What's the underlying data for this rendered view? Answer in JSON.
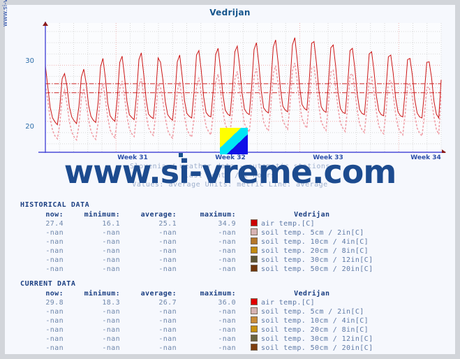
{
  "site": {
    "vertical_label": "www.si-vreme.com",
    "watermark": "www.si-vreme.com"
  },
  "header": {
    "title": "Vedrijan"
  },
  "captions": {
    "line1": "Slovenia / weather data - automatic stations",
    "line2": "last month / 2 hours",
    "line3": "Values: average  Units: metric  Line: average"
  },
  "chart_data": {
    "type": "line",
    "title": "Vedrijan",
    "xlabel": "",
    "ylabel": "",
    "ylim": [
      14.5,
      37.5
    ],
    "yticks": [
      20,
      30
    ],
    "ytick_labels": [
      "20",
      "30"
    ],
    "xtick_labels": [
      "Week 31",
      "Week 32",
      "Week 33",
      "Week 34"
    ],
    "xtick_positions": [
      0.172,
      0.413,
      0.654,
      0.895
    ],
    "grid": true,
    "legend_position": "below-table",
    "annotations": [
      "average line current 26.7",
      "average line historical 25.1"
    ],
    "series": [
      {
        "name": "air temp.[C] current",
        "color": "#cc1414",
        "style": "solid",
        "values": [
          29.9,
          26.2,
          22.5,
          20.6,
          19.9,
          19.4,
          22.5,
          27.6,
          28.5,
          26.3,
          22.6,
          20.8,
          20.1,
          19.6,
          22.7,
          27.9,
          29.3,
          26.8,
          22.9,
          20.9,
          20.2,
          19.8,
          23.4,
          29.7,
          31.2,
          27.8,
          23.2,
          21.0,
          20.4,
          20.0,
          24.2,
          30.5,
          31.6,
          28.0,
          23.6,
          21.2,
          20.7,
          20.3,
          24.7,
          31.0,
          32.2,
          28.4,
          23.9,
          21.3,
          20.8,
          20.5,
          25.0,
          31.3,
          30.5,
          27.4,
          23.5,
          21.2,
          20.6,
          20.2,
          24.4,
          30.6,
          31.8,
          28.1,
          23.7,
          21.4,
          20.9,
          20.6,
          25.3,
          31.8,
          32.6,
          29.0,
          24.3,
          21.6,
          21.0,
          20.8,
          25.6,
          31.9,
          33.0,
          29.4,
          24.8,
          22.0,
          21.3,
          21.0,
          25.9,
          32.4,
          33.4,
          29.8,
          25.1,
          22.2,
          21.5,
          21.2,
          26.2,
          32.8,
          34.0,
          30.2,
          25.4,
          22.4,
          21.8,
          21.5,
          26.6,
          33.2,
          34.5,
          30.6,
          25.8,
          22.7,
          22.0,
          21.7,
          26.9,
          33.6,
          34.9,
          31.0,
          26.1,
          23.0,
          22.3,
          22.0,
          27.2,
          33.9,
          34.2,
          30.4,
          25.6,
          22.6,
          21.9,
          21.6,
          26.8,
          33.1,
          33.6,
          29.9,
          25.2,
          22.3,
          21.6,
          21.4,
          26.4,
          32.6,
          33.0,
          29.5,
          24.9,
          22.1,
          21.4,
          21.2,
          26.0,
          32.0,
          32.4,
          29.0,
          24.5,
          21.9,
          21.2,
          21.0,
          25.7,
          31.5,
          31.8,
          28.6,
          24.2,
          21.7,
          21.0,
          20.8,
          25.4,
          31.0,
          31.2,
          28.2,
          23.9,
          21.5,
          20.8,
          20.6,
          25.1,
          30.5,
          30.6,
          27.8,
          23.6,
          21.3,
          20.6,
          27.4
        ]
      },
      {
        "name": "air temp.[C] historical",
        "color": "#f0a0a8",
        "style": "dashed",
        "values": [
          26.5,
          23.8,
          20.5,
          18.4,
          17.4,
          16.9,
          19.5,
          24.4,
          25.6,
          23.2,
          20.0,
          18.1,
          17.2,
          16.7,
          19.3,
          24.1,
          25.9,
          23.5,
          20.3,
          18.3,
          17.3,
          16.8,
          19.8,
          25.0,
          26.8,
          24.0,
          20.7,
          18.5,
          17.6,
          17.1,
          20.4,
          25.8,
          27.2,
          24.4,
          21.0,
          18.7,
          17.8,
          17.3,
          20.8,
          26.3,
          27.6,
          24.7,
          21.3,
          18.9,
          18.0,
          17.5,
          21.2,
          26.7,
          26.1,
          23.6,
          20.6,
          18.4,
          17.5,
          17.0,
          20.1,
          25.4,
          27.0,
          24.2,
          20.9,
          18.6,
          17.7,
          17.2,
          20.6,
          26.1,
          27.8,
          25.0,
          21.5,
          19.1,
          18.2,
          17.6,
          21.5,
          27.0,
          28.4,
          25.5,
          21.9,
          19.4,
          18.5,
          17.9,
          21.9,
          27.5,
          28.9,
          25.9,
          22.2,
          19.6,
          18.7,
          18.1,
          22.3,
          28.0,
          29.4,
          26.3,
          22.6,
          19.9,
          18.9,
          18.3,
          22.7,
          28.5,
          29.9,
          26.8,
          23.0,
          20.2,
          19.2,
          18.6,
          23.1,
          29.0,
          30.4,
          27.2,
          23.3,
          20.5,
          19.4,
          18.8,
          23.5,
          29.5,
          29.7,
          26.6,
          22.8,
          20.0,
          19.0,
          18.4,
          23.0,
          28.8,
          29.1,
          26.1,
          22.4,
          19.7,
          18.8,
          18.2,
          22.5,
          28.2,
          28.5,
          25.7,
          22.0,
          19.5,
          18.5,
          18.0,
          22.1,
          27.6,
          27.9,
          25.2,
          21.7,
          19.2,
          18.3,
          17.8,
          21.7,
          27.1,
          27.3,
          24.8,
          21.4,
          19.0,
          18.1,
          17.6,
          21.3,
          26.5,
          26.7,
          24.3,
          21.1,
          18.8,
          17.9,
          17.4,
          20.9,
          26.0,
          26.1,
          23.9,
          20.8,
          18.6,
          17.7,
          24.9
        ]
      }
    ],
    "avg_lines": [
      {
        "name": "current average",
        "value": 26.7,
        "color": "#cc2222"
      },
      {
        "name": "historical average",
        "value": 25.1,
        "color": "#cc2222"
      }
    ]
  },
  "historical": {
    "title": "HISTORICAL DATA",
    "columns": [
      "now:",
      "minimum:",
      "average:",
      "maximum:"
    ],
    "station": "Vedrijan",
    "rows": [
      {
        "now": "27.4",
        "minimum": "16.1",
        "average": "25.1",
        "maximum": "34.9",
        "color": "#cc0000",
        "label": "air temp.[C]"
      },
      {
        "now": "-nan",
        "minimum": "-nan",
        "average": "-nan",
        "maximum": "-nan",
        "color": "#d6b2b2",
        "label": "soil temp. 5cm / 2in[C]"
      },
      {
        "now": "-nan",
        "minimum": "-nan",
        "average": "-nan",
        "maximum": "-nan",
        "color": "#b4762a",
        "label": "soil temp. 10cm / 4in[C]"
      },
      {
        "now": "-nan",
        "minimum": "-nan",
        "average": "-nan",
        "maximum": "-nan",
        "color": "#c28a10",
        "label": "soil temp. 20cm / 8in[C]"
      },
      {
        "now": "-nan",
        "minimum": "-nan",
        "average": "-nan",
        "maximum": "-nan",
        "color": "#5c5534",
        "label": "soil temp. 30cm / 12in[C]"
      },
      {
        "now": "-nan",
        "minimum": "-nan",
        "average": "-nan",
        "maximum": "-nan",
        "color": "#70360c",
        "label": "soil temp. 50cm / 20in[C]"
      }
    ]
  },
  "current": {
    "title": "CURRENT DATA",
    "columns": [
      "now:",
      "minimum:",
      "average:",
      "maximum:"
    ],
    "station": "Vedrijan",
    "rows": [
      {
        "now": "29.8",
        "minimum": "18.3",
        "average": "26.7",
        "maximum": "36.0",
        "color": "#e00000",
        "label": "air temp.[C]"
      },
      {
        "now": "-nan",
        "minimum": "-nan",
        "average": "-nan",
        "maximum": "-nan",
        "color": "#d6b2b2",
        "label": "soil temp. 5cm / 2in[C]"
      },
      {
        "now": "-nan",
        "minimum": "-nan",
        "average": "-nan",
        "maximum": "-nan",
        "color": "#c98b38",
        "label": "soil temp. 10cm / 4in[C]"
      },
      {
        "now": "-nan",
        "minimum": "-nan",
        "average": "-nan",
        "maximum": "-nan",
        "color": "#c79010",
        "label": "soil temp. 20cm / 8in[C]"
      },
      {
        "now": "-nan",
        "minimum": "-nan",
        "average": "-nan",
        "maximum": "-nan",
        "color": "#6a6340",
        "label": "soil temp. 30cm / 12in[C]"
      },
      {
        "now": "-nan",
        "minimum": "-nan",
        "average": "-nan",
        "maximum": "-nan",
        "color": "#7d3d0e",
        "label": "soil temp. 50cm / 20in[C]"
      }
    ]
  },
  "colors": {
    "panel_bg": "#f6f8fd",
    "outer_bg": "#d2d5da",
    "title_blue": "#15558c",
    "axis_blue": "#4a4ad8",
    "series_red": "#cc1414",
    "series_pink": "#f0a0a8",
    "watermark_blue": "#1c4b8f"
  }
}
